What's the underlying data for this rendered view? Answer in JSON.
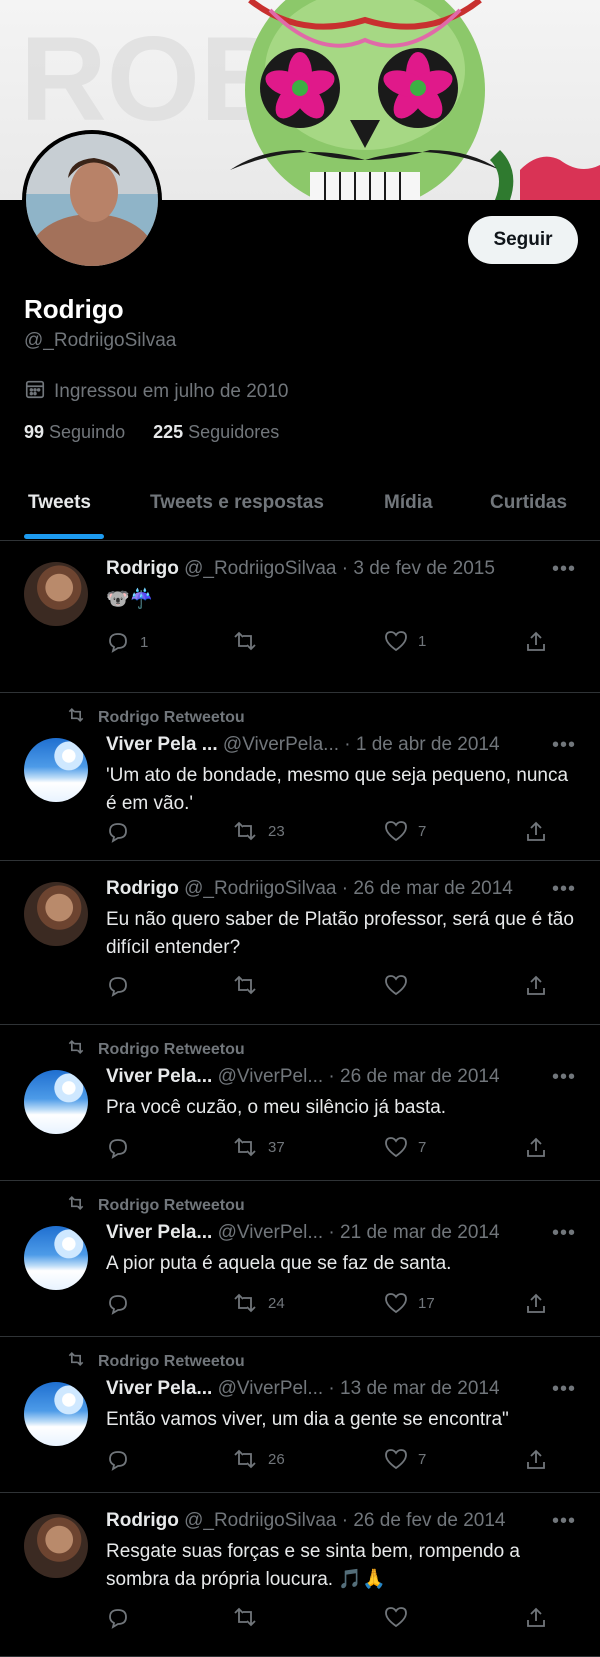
{
  "profile": {
    "name": "Rodrigo",
    "handle": "@_RodriigoSilvaa",
    "joined": "Ingressou em julho de 2010",
    "following_count": "99",
    "following_label": "Seguindo",
    "followers_count": "225",
    "followers_label": "Seguidores",
    "follow_button": "Seguir"
  },
  "tabs": [
    {
      "label": "Tweets"
    },
    {
      "label": "Tweets e respostas"
    },
    {
      "label": "Mídia"
    },
    {
      "label": "Curtidas"
    }
  ],
  "tweets": [
    {
      "retweet_label": "",
      "name": "Rodrigo",
      "meta": "@_RodriigoSilvaa · 3 de fev de 2015",
      "text": "🐨☔",
      "replies": "1",
      "retweets": "",
      "likes": "1",
      "avatar": "person"
    },
    {
      "retweet_label": "Rodrigo Retweetou",
      "name": "Viver Pela ...",
      "meta": "@ViverPela...   · 1 de abr de 2014",
      "text": "'Um ato de bondade, mesmo que seja pequeno, nunca é em vão.'",
      "replies": "",
      "retweets": "23",
      "likes": "7",
      "avatar": "sky"
    },
    {
      "retweet_label": "",
      "name": "Rodrigo",
      "meta": "@_RodriigoSilvaa · 26 de mar de 2014",
      "text": "Eu não quero saber de Platão professor, será que é tão difícil entender?",
      "replies": "",
      "retweets": "",
      "likes": "",
      "avatar": "person"
    },
    {
      "retweet_label": "Rodrigo Retweetou",
      "name": "Viver Pela...",
      "meta": "@ViverPel...   · 26 de mar de 2014",
      "text": "Pra você cuzão, o meu silêncio já basta.",
      "replies": "",
      "retweets": "37",
      "likes": "7",
      "avatar": "sky"
    },
    {
      "retweet_label": "Rodrigo Retweetou",
      "name": "Viver Pela...",
      "meta": "@ViverPel...   · 21 de mar de 2014",
      "text": "A pior puta é aquela que se faz de santa.",
      "replies": "",
      "retweets": "24",
      "likes": "17",
      "avatar": "sky"
    },
    {
      "retweet_label": "Rodrigo Retweetou",
      "name": "Viver Pela...",
      "meta": "@ViverPel...   · 13 de mar de 2014",
      "text": "Então vamos viver, um dia a gente se encontra\"",
      "replies": "",
      "retweets": "26",
      "likes": "7",
      "avatar": "sky"
    },
    {
      "retweet_label": "",
      "name": "Rodrigo",
      "meta": "@_RodriigoSilvaa · 26 de fev de 2014",
      "text": "Resgate suas forças e se sinta bem, rompendo a sombra da própria loucura. 🎵🙏",
      "replies": "",
      "retweets": "",
      "likes": "",
      "avatar": "person"
    }
  ],
  "colors": {
    "background": "#000000",
    "text": "#e7e9ea",
    "secondary": "#71767b",
    "accent": "#1d9bf0",
    "divider": "#2f3336"
  }
}
